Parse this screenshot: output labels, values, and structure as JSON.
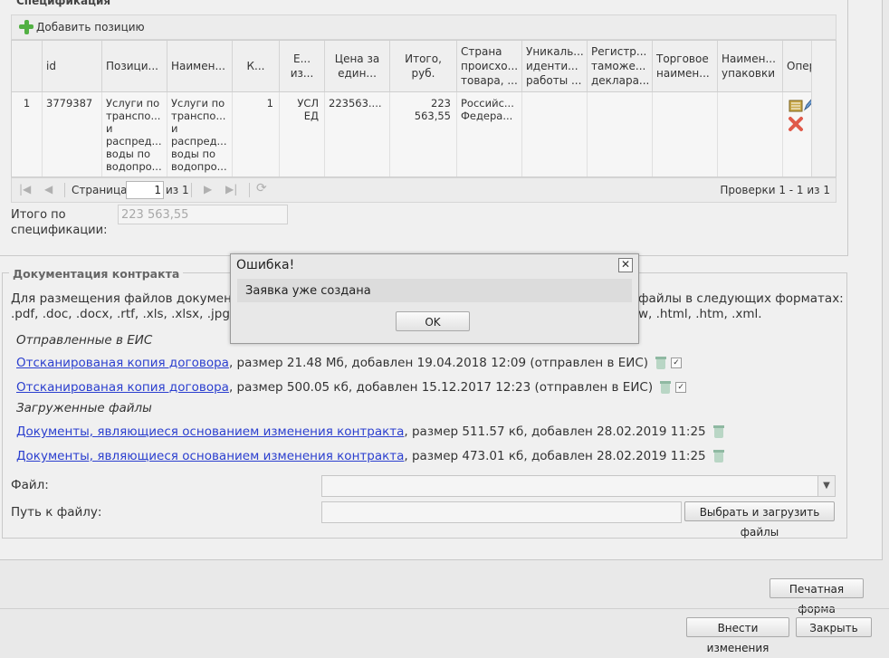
{
  "spec": {
    "title": "Спецификация",
    "add_label": "Добавить позицию",
    "columns": [
      "",
      "id",
      "Позици...",
      "Наимен...",
      "К...",
      "Е... из...",
      "Цена за един...",
      "Итого, руб.",
      "Страна происхо... товара, ...",
      "Уникаль... иденти... работы ...",
      "Регистр... таможе... деклара...",
      "Торговое наимен...",
      "Наимен... упаковки",
      "Опера..."
    ],
    "row": {
      "num": "1",
      "id": "3779387",
      "position": "Услуги по транспо... и распред... воды по водопро...",
      "name": "Услуги по транспо... и распред... воды по водопро...",
      "qty": "1",
      "unit": "УСЛ ЕД",
      "price": "223563....",
      "total": "223 563,55",
      "country": "Российс... Федера..."
    },
    "pager": {
      "page_label": "Страница",
      "page_value": "1",
      "of_label": "из 1",
      "status": "Проверки 1 - 1 из 1"
    },
    "total_label": "Итого по спецификации:",
    "total_value": "223 563,55"
  },
  "docs": {
    "title": "Документация контракта",
    "intro_left": "Для размещения файлов документац",
    "intro_left2": ".pdf, .doc, .docx, .rtf, .xls, .xlsx, .jpg, .jp",
    "intro_right": "файлы в следующих форматах:",
    "intro_right2": "w, .html, .htm, .xml.",
    "sent_title": "Отправленные в ЕИС",
    "sent": [
      {
        "link": "Отсканированая копия договора",
        "info": ", размер 21.48 Мб, добавлен 19.04.2018 12:09 (отправлен в ЕИС)"
      },
      {
        "link": "Отсканированая копия договора",
        "info": ", размер 500.05 кб, добавлен 15.12.2017 12:23 (отправлен в ЕИС)"
      }
    ],
    "uploaded_title": "Загруженные файлы",
    "uploaded": [
      {
        "link": "Документы, являющиеся основанием изменения контракта",
        "info": ", размер 511.57 кб, добавлен 28.02.2019 11:25"
      },
      {
        "link": "Документы, являющиеся основанием изменения контракта",
        "info": ", размер 473.01 кб, добавлен 28.02.2019 11:25"
      }
    ],
    "file_label": "Файл:",
    "path_label": "Путь к файлу:",
    "upload_button": "Выбрать и загрузить файлы"
  },
  "buttons": {
    "print": "Печатная форма",
    "apply": "Внести изменения",
    "close": "Закрыть"
  },
  "dialog": {
    "title": "Ошибка!",
    "message": "Заявка уже создана",
    "ok": "OK",
    "close_glyph": "✕"
  }
}
